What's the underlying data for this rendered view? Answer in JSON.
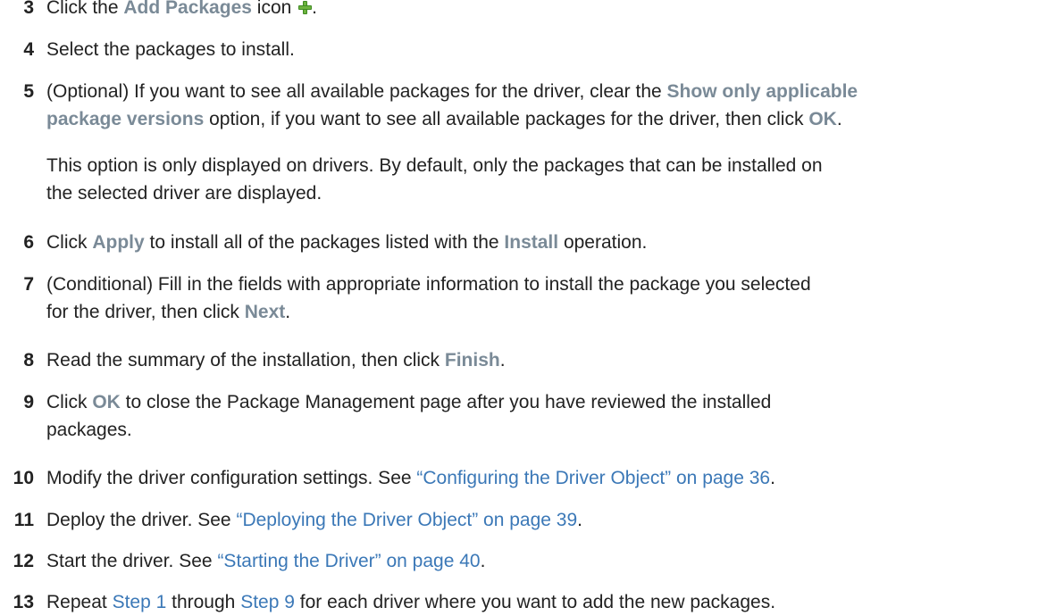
{
  "steps": [
    {
      "num": "3",
      "parts": [
        "Click the ",
        {
          "ui": "Add Packages"
        },
        " icon ",
        {
          "icon": "add-packages-icon"
        },
        "."
      ]
    },
    {
      "num": "4",
      "parts": [
        "Select the packages to install."
      ]
    },
    {
      "num": "5",
      "parts": [
        "(Optional) If you want to see all available packages for the driver, clear the ",
        {
          "ui": "Show only applicable"
        },
        {
          "br": true
        },
        {
          "ui": "package versions"
        },
        " option, if you want to see all available packages for the driver, then click ",
        {
          "ui": "OK"
        },
        "."
      ]
    },
    {
      "num": "",
      "parts": [
        "This option is only displayed on drivers. By default, only the packages that can be installed on",
        {
          "br": true
        },
        "the selected driver are displayed."
      ]
    },
    {
      "num": "6",
      "parts": [
        "Click ",
        {
          "ui": "Apply"
        },
        " to install all of the packages listed with the ",
        {
          "ui": "Install"
        },
        " operation."
      ]
    },
    {
      "num": "7",
      "parts": [
        "(Conditional) Fill in the fields with appropriate information to install the package you selected",
        {
          "br": true
        },
        "for the driver, then click ",
        {
          "ui": "Next"
        },
        "."
      ]
    },
    {
      "num": "8",
      "parts": [
        "Read the summary of the installation, then click ",
        {
          "ui": "Finish"
        },
        "."
      ]
    },
    {
      "num": "9",
      "parts": [
        "Click ",
        {
          "ui": "OK"
        },
        " to close the Package Management page after you have reviewed the installed",
        {
          "br": true
        },
        "packages."
      ]
    },
    {
      "num": "10",
      "parts": [
        "Modify the driver configuration settings. See ",
        {
          "link": "“Configuring the Driver Object” on page 36"
        },
        "."
      ]
    },
    {
      "num": "11",
      "parts": [
        "Deploy the driver. See ",
        {
          "link": "“Deploying the Driver Object” on page 39"
        },
        "."
      ]
    },
    {
      "num": "12",
      "parts": [
        "Start the driver. See ",
        {
          "link": "“Starting the Driver” on page 40"
        },
        "."
      ]
    },
    {
      "num": "13",
      "parts": [
        "Repeat ",
        {
          "link": "Step 1"
        },
        " through ",
        {
          "link": "Step 9"
        },
        " for each driver where you want to add the new packages."
      ]
    }
  ],
  "colors": {
    "text": "#222222",
    "ui_term": "#7a8a97",
    "link": "#3b78b7",
    "icon_green": "#6cb33e"
  }
}
